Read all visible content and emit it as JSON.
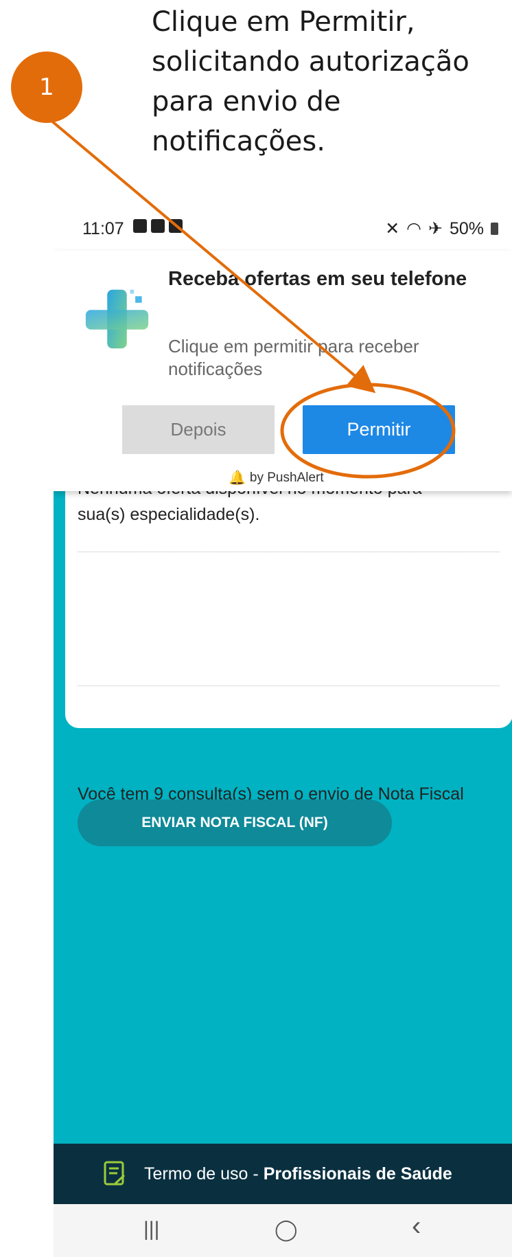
{
  "annotation": {
    "step_number": "1",
    "instruction_lines": [
      "Clique em Permitir,",
      "solicitando autorização",
      "para envio de",
      "notificações."
    ],
    "accent_color": "#e36c0a"
  },
  "status_bar": {
    "time": "11:07",
    "battery": "50%"
  },
  "popup": {
    "title": "Receba ofertas em seu telefone",
    "message": "Clique em permitir para receber notificações",
    "later_label": "Depois",
    "allow_label": "Permitir",
    "powered_by": "by PushAlert"
  },
  "content": {
    "no_offers_text_line1": "Nenhuma oferta disponível no momento para",
    "no_offers_text_line2": "sua(s) especialidade(s).",
    "pending_invoices_text": "Você tem 9 consulta(s) sem o envio de Nota Fiscal",
    "send_invoice_label": "ENVIAR NOTA FISCAL (NF)",
    "background_color": "#00b2c2"
  },
  "footer": {
    "terms_prefix": "Termo de uso - ",
    "terms_bold": "Profissionais de Saúde"
  },
  "navbar": {
    "recent": "|||",
    "home": "◯",
    "back": "‹"
  }
}
